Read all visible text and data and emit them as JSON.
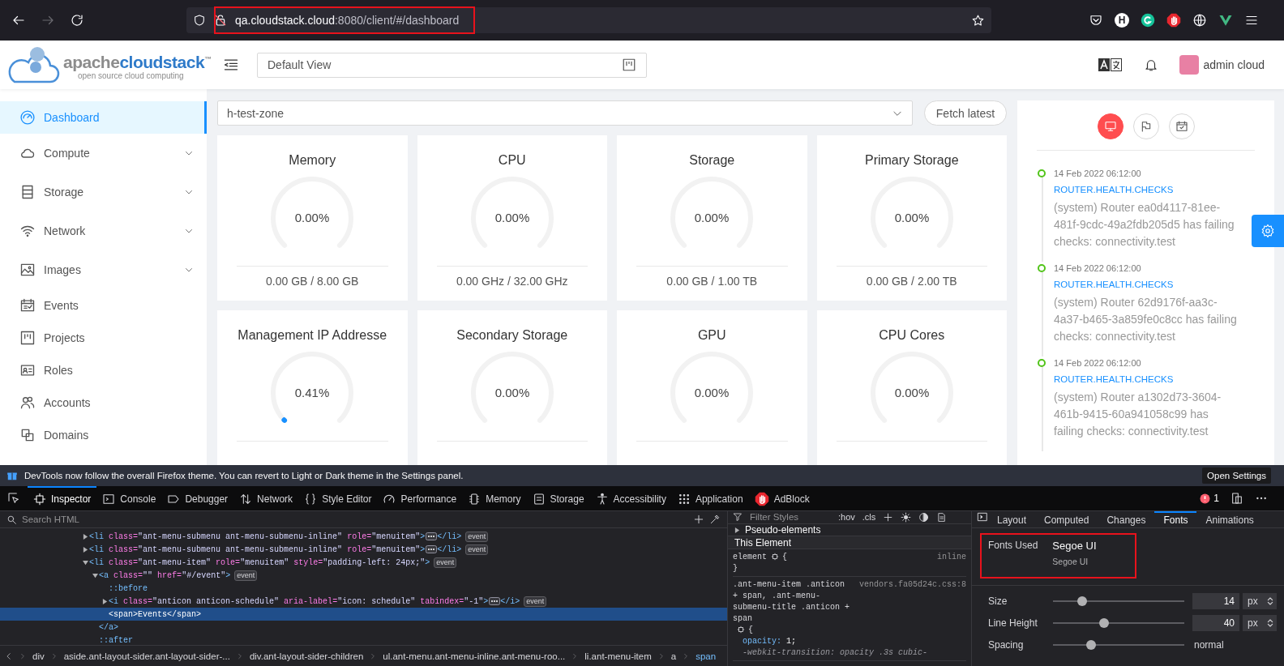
{
  "browser": {
    "url_host": "qa.cloudstack.cloud",
    "url_rest": ":8080/client/#/dashboard",
    "annotated": true,
    "forward_disabled": true,
    "extension_letter": "H"
  },
  "app_header": {
    "logo_main": "apache",
    "logo_accent": "cloudstack",
    "logo_mark": "™",
    "tagline": "open source cloud computing",
    "view": "Default View",
    "user": "admin cloud"
  },
  "sidebar": [
    {
      "label": "Dashboard",
      "kind": "dashboard",
      "has_submenu": false,
      "selected": true
    },
    {
      "label": "Compute",
      "kind": "cloud",
      "has_submenu": true,
      "selected": false
    },
    {
      "label": "Storage",
      "kind": "storage",
      "has_submenu": true,
      "selected": false
    },
    {
      "label": "Network",
      "kind": "wifi",
      "has_submenu": true,
      "selected": false
    },
    {
      "label": "Images",
      "kind": "image",
      "has_submenu": true,
      "selected": false
    },
    {
      "label": "Events",
      "kind": "schedule",
      "has_submenu": false,
      "selected": false
    },
    {
      "label": "Projects",
      "kind": "project",
      "has_submenu": false,
      "selected": false
    },
    {
      "label": "Roles",
      "kind": "idcard",
      "has_submenu": false,
      "selected": false
    },
    {
      "label": "Accounts",
      "kind": "team",
      "has_submenu": false,
      "selected": false
    },
    {
      "label": "Domains",
      "kind": "block",
      "has_submenu": false,
      "selected": false
    }
  ],
  "zone": "h-test-zone",
  "fetch_button": "Fetch latest",
  "cards": [
    {
      "title": "Memory",
      "percent": "0.00%",
      "detail": "0.00 GB / 8.00 GB"
    },
    {
      "title": "CPU",
      "percent": "0.00%",
      "detail": "0.00 GHz / 32.00 GHz"
    },
    {
      "title": "Storage",
      "percent": "0.00%",
      "detail": "0.00 GB / 1.00 TB"
    },
    {
      "title": "Primary Storage",
      "percent": "0.00%",
      "detail": "0.00 GB / 2.00 TB"
    },
    {
      "title": "Management IP Addresse",
      "percent": "0.41%"
    },
    {
      "title": "Secondary Storage",
      "percent": "0.00%"
    },
    {
      "title": "GPU",
      "percent": "0.00%"
    },
    {
      "title": "CPU Cores",
      "percent": "0.00%"
    }
  ],
  "activity": {
    "tabs": [
      {
        "kind": "monitor",
        "selected": true
      },
      {
        "kind": "flag",
        "selected": false
      },
      {
        "kind": "calendar",
        "selected": false
      }
    ],
    "events": [
      {
        "time": "14 Feb 2022 06:12:00",
        "type": "ROUTER.HEALTH.CHECKS",
        "description": "(system) Router ea0d4117-81ee-481f-9cdc-49a2fdb205d5 has failing checks: connectivity.test"
      },
      {
        "time": "14 Feb 2022 06:12:00",
        "type": "ROUTER.HEALTH.CHECKS",
        "description": "(system) Router 62d9176f-aa3c-4a37-b465-3a859fe0c8cc has failing checks: connectivity.test"
      },
      {
        "time": "14 Feb 2022 06:12:00",
        "type": "ROUTER.HEALTH.CHECKS",
        "description": "(system) Router a1302d73-3604-461b-9415-60a941058c99 has failing checks: connectivity.test"
      }
    ]
  },
  "devtools": {
    "notice": "DevTools now follow the overall Firefox theme. You can revert to Light or Dark theme in the Settings panel.",
    "notice_button": "Open Settings",
    "tabs": [
      {
        "label": "Inspector",
        "kind": "inspector",
        "selected": true
      },
      {
        "label": "Console",
        "kind": "console",
        "selected": false
      },
      {
        "label": "Debugger",
        "kind": "debugger",
        "selected": false
      },
      {
        "label": "Network",
        "kind": "network",
        "selected": false
      },
      {
        "label": "Style Editor",
        "kind": "style",
        "selected": false
      },
      {
        "label": "Performance",
        "kind": "performance",
        "selected": false
      },
      {
        "label": "Memory",
        "kind": "memory",
        "selected": false
      },
      {
        "label": "Storage",
        "kind": "storage",
        "selected": false
      },
      {
        "label": "Accessibility",
        "kind": "accessibility",
        "selected": false
      },
      {
        "label": "Application",
        "kind": "application",
        "selected": false
      },
      {
        "label": "AdBlock",
        "kind": "adblock",
        "selected": false
      }
    ],
    "error_count": "1",
    "html_search_placeholder": "Search HTML",
    "html_tree": [
      {
        "kind": "element",
        "text": "<li class=\"ant-menu-submenu ant-menu-submenu-inline\" role=\"menuitem\">",
        "expanded": false,
        "selected": false,
        "closing": "</li>",
        "badge": "event"
      },
      {
        "kind": "element",
        "text": "<li class=\"ant-menu-submenu ant-menu-submenu-inline\" role=\"menuitem\">",
        "expanded": false,
        "selected": false,
        "closing": "</li>",
        "badge": "event"
      },
      {
        "kind": "element",
        "text": "<li class=\"ant-menu-item\" role=\"menuitem\" style=\"padding-left: 24px;\">",
        "expanded": true,
        "selected": false,
        "badge": "event",
        "children": [
          {
            "kind": "element",
            "text": "<a class=\"\" href=\"#/event\">",
            "expanded": true,
            "selected": false,
            "badge": "event",
            "end_tag": "</a>",
            "children": [
              {
                "kind": "pseudo",
                "text": "::before",
                "selected": false
              },
              {
                "kind": "element",
                "text": "<i class=\"anticon anticon-schedule\" aria-label=\"icon: schedule\" tabindex=\"-1\">",
                "expanded": false,
                "selected": false,
                "closing": "</i>",
                "badge": "event"
              },
              {
                "kind": "leaf",
                "text": "<span>Events</span>",
                "selected": true
              }
            ]
          },
          {
            "kind": "pseudo",
            "text": "::after",
            "selected": false
          }
        ]
      }
    ],
    "breadcrumbs": [
      {
        "label": "div",
        "selected": false
      },
      {
        "label": "aside.ant-layout-sider.ant-layout-sider-...",
        "selected": false
      },
      {
        "label": "div.ant-layout-sider-children",
        "selected": false
      },
      {
        "label": "ul.ant-menu.ant-menu-inline.ant-menu-roo...",
        "selected": false
      },
      {
        "label": "li.ant-menu-item",
        "selected": false
      },
      {
        "label": "a",
        "selected": false
      },
      {
        "label": "span",
        "selected": true
      }
    ],
    "rules": {
      "filter_placeholder": "Filter Styles",
      "hov": ":hov",
      "cls": ".cls",
      "pseudo_header": "Pseudo-elements",
      "element_header": "This Element",
      "blocks": [
        {
          "selector": "element",
          "open": "{",
          "source": "inline",
          "close": "}"
        },
        {
          "selector": ".ant-menu-item .anticon + span, .ant-menu-submenu-title .anticon + span",
          "open": "{",
          "source": "vendors.fa05d24c.css:8",
          "declarations": [
            {
              "property": "opacity:",
              "value": "1;",
              "overridden": false
            },
            {
              "property": "-webkit-transition:",
              "value": "opacity .3s cubic-",
              "overridden": true
            }
          ]
        }
      ]
    },
    "side_tabs": [
      {
        "label": "Layout",
        "selected": false
      },
      {
        "label": "Computed",
        "selected": false
      },
      {
        "label": "Changes",
        "selected": false
      },
      {
        "label": "Fonts",
        "selected": true
      },
      {
        "label": "Animations",
        "selected": false
      }
    ],
    "fonts_used": {
      "label": "Fonts Used",
      "name": "Segoe UI",
      "family": "Segoe UI",
      "annotated": true
    },
    "font_props": [
      {
        "label": "Size",
        "level": 0.2,
        "value": "14",
        "unit": "px"
      },
      {
        "label": "Line Height",
        "level": 0.38,
        "value": "40",
        "unit": "px"
      },
      {
        "label": "Spacing",
        "level": 0.27,
        "value": "normal"
      }
    ]
  }
}
